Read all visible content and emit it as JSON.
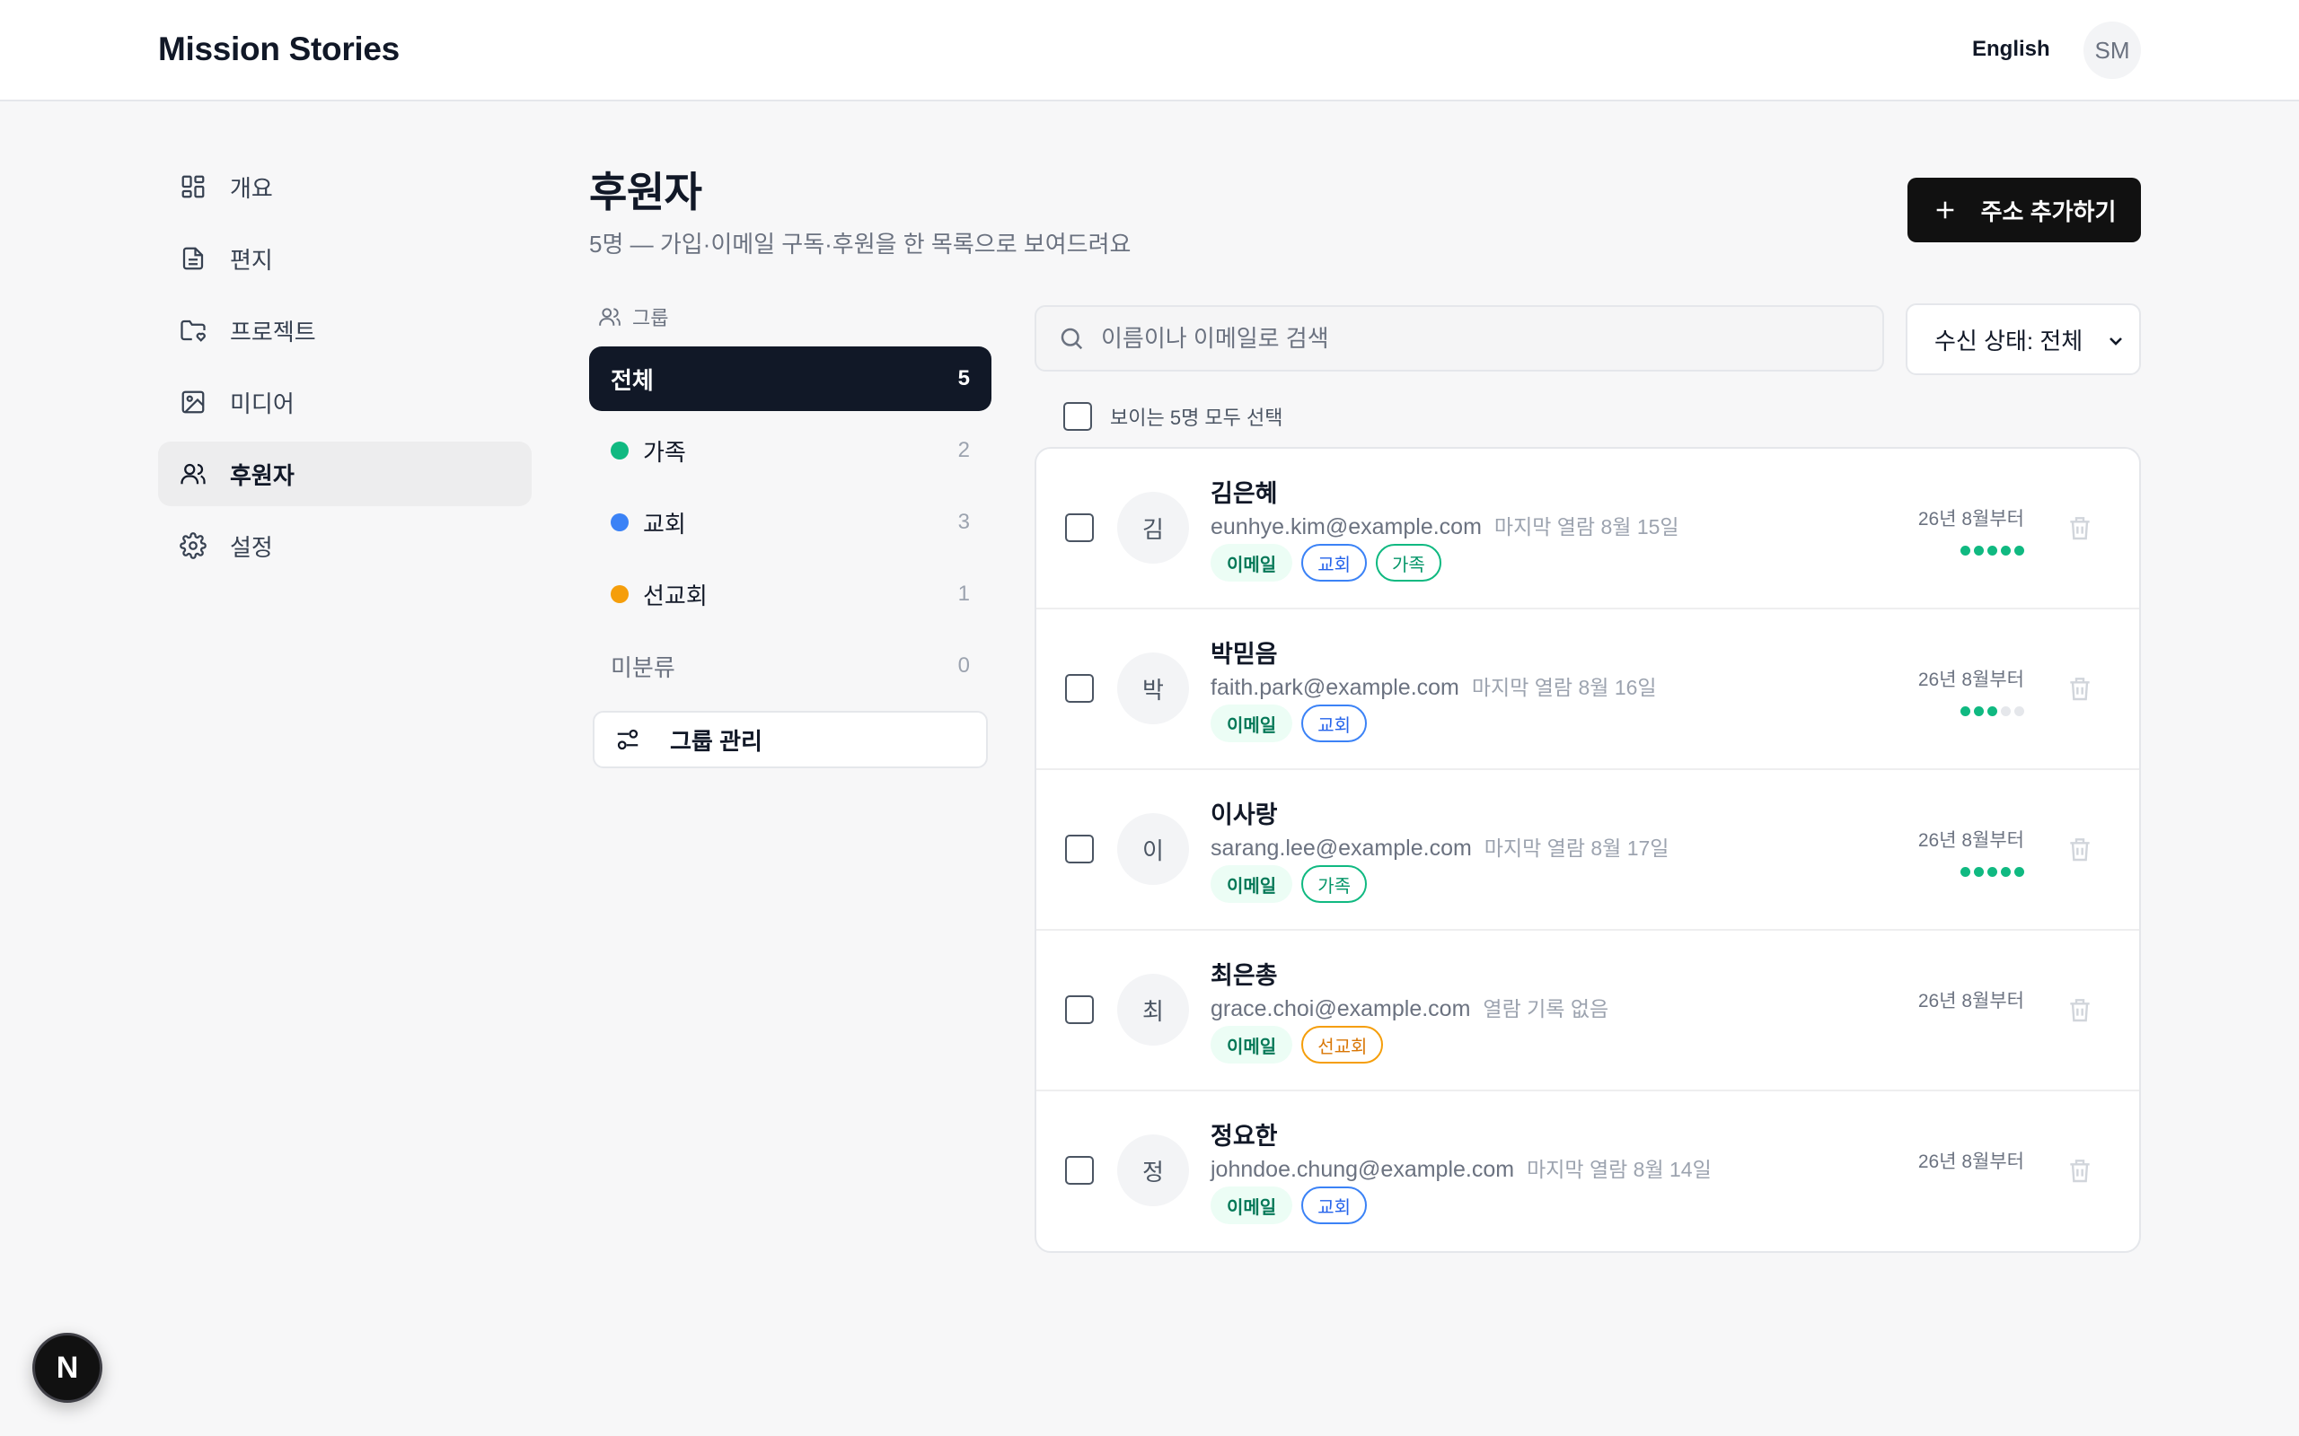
{
  "header": {
    "brand": "Mission Stories",
    "language": "English",
    "user_initials": "SM"
  },
  "sidebar": {
    "items": [
      {
        "label": "개요",
        "icon": "grid-icon",
        "active": false
      },
      {
        "label": "편지",
        "icon": "document-icon",
        "active": false
      },
      {
        "label": "프로젝트",
        "icon": "folder-heart-icon",
        "active": false
      },
      {
        "label": "미디어",
        "icon": "image-icon",
        "active": false
      },
      {
        "label": "후원자",
        "icon": "users-icon",
        "active": true
      },
      {
        "label": "설정",
        "icon": "gear-icon",
        "active": false
      }
    ]
  },
  "page": {
    "title": "후원자",
    "subtitle": "5명 — 가입·이메일 구독·후원을 한 목록으로 보여드려요",
    "add_button": "주소 추가하기"
  },
  "groups": {
    "heading": "그룹",
    "items": [
      {
        "label": "전체",
        "count": "5",
        "color": "",
        "active": true
      },
      {
        "label": "가족",
        "count": "2",
        "color": "#10b981",
        "active": false
      },
      {
        "label": "교회",
        "count": "3",
        "color": "#3b82f6",
        "active": false
      },
      {
        "label": "선교회",
        "count": "1",
        "color": "#f59e0b",
        "active": false
      },
      {
        "label": "미분류",
        "count": "0",
        "color": "",
        "active": false
      }
    ],
    "manage_button": "그룹 관리"
  },
  "search": {
    "placeholder": "이름이나 이메일로 검색",
    "value": ""
  },
  "filter": {
    "selected": "수신 상태: 전체"
  },
  "select_all_label": "보이는 5명 모두 선택",
  "supporters": [
    {
      "initial": "김",
      "name": "김은혜",
      "email": "eunhye.kim@example.com",
      "last_open": "마지막 열람 8월 15일",
      "tags": [
        {
          "label": "이메일",
          "kind": "email"
        },
        {
          "label": "교회",
          "kind": "blue"
        },
        {
          "label": "가족",
          "kind": "green"
        }
      ],
      "since": "26년 8월부터",
      "engagement": 5
    },
    {
      "initial": "박",
      "name": "박믿음",
      "email": "faith.park@example.com",
      "last_open": "마지막 열람 8월 16일",
      "tags": [
        {
          "label": "이메일",
          "kind": "email"
        },
        {
          "label": "교회",
          "kind": "blue"
        }
      ],
      "since": "26년 8월부터",
      "engagement": 3
    },
    {
      "initial": "이",
      "name": "이사랑",
      "email": "sarang.lee@example.com",
      "last_open": "마지막 열람 8월 17일",
      "tags": [
        {
          "label": "이메일",
          "kind": "email"
        },
        {
          "label": "가족",
          "kind": "green"
        }
      ],
      "since": "26년 8월부터",
      "engagement": 5
    },
    {
      "initial": "최",
      "name": "최은총",
      "email": "grace.choi@example.com",
      "last_open": "열람 기록 없음",
      "tags": [
        {
          "label": "이메일",
          "kind": "email"
        },
        {
          "label": "선교회",
          "kind": "orange"
        }
      ],
      "since": "26년 8월부터",
      "engagement": null
    },
    {
      "initial": "정",
      "name": "정요한",
      "email": "johndoe.chung@example.com",
      "last_open": "마지막 열람 8월 14일",
      "tags": [
        {
          "label": "이메일",
          "kind": "email"
        },
        {
          "label": "교회",
          "kind": "blue"
        }
      ],
      "since": "26년 8월부터",
      "engagement": null
    }
  ],
  "floating_badge": "N"
}
